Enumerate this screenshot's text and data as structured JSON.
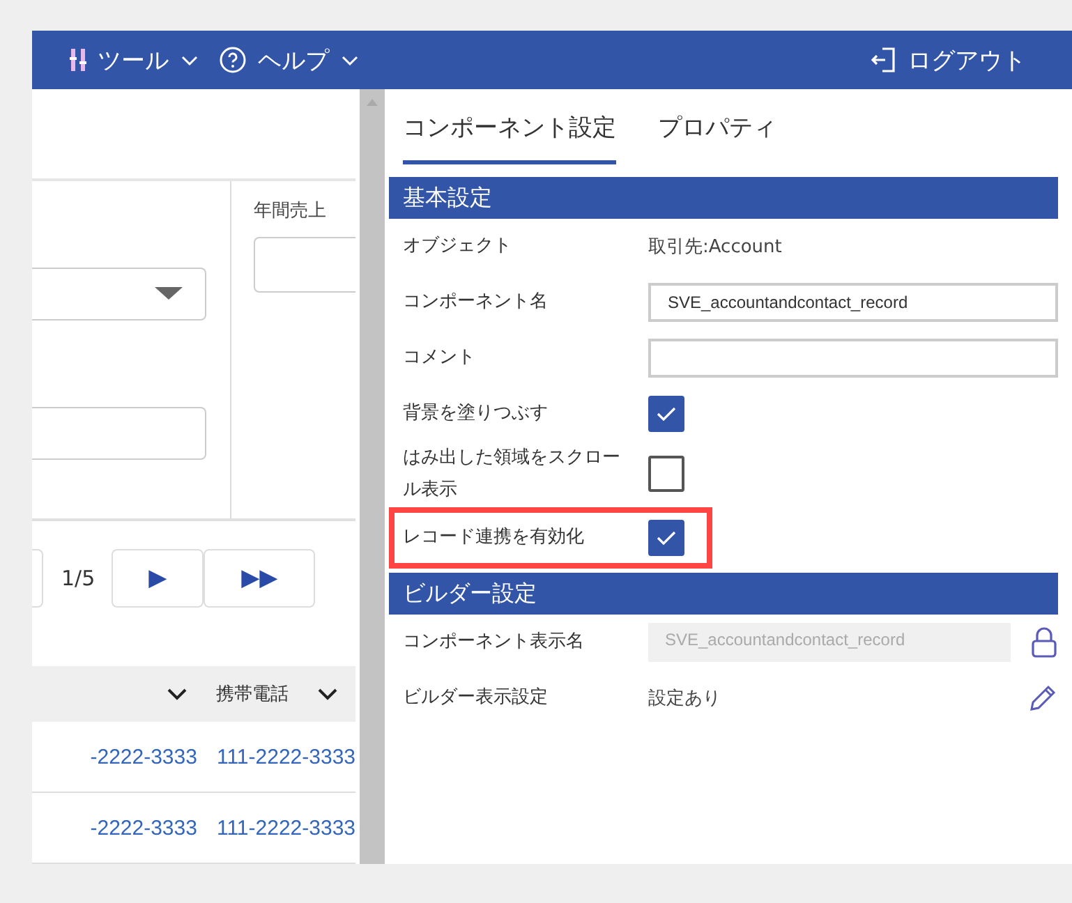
{
  "header": {
    "menus": [
      {
        "label": "ツール",
        "kind": "tools"
      },
      {
        "label": "ヘルプ",
        "kind": "help"
      }
    ],
    "logout": "ログアウト"
  },
  "left": {
    "field_label": "年間売上",
    "pager": {
      "page": "1/5",
      "next": "▶",
      "last": "▶▶"
    },
    "table": {
      "columns": [
        {
          "kind": "unlabeled"
        },
        {
          "kind": "labeled",
          "label": "携帯電話"
        }
      ],
      "rows": [
        [
          "-2222-3333",
          "111-2222-3333"
        ],
        [
          "-2222-3333",
          "111-2222-3333"
        ]
      ]
    }
  },
  "tabs": [
    {
      "label": "コンポーネント設定",
      "selected": true
    },
    {
      "label": "プロパティ",
      "selected": false
    }
  ],
  "sections": [
    {
      "title": "基本設定",
      "rows": [
        {
          "kind": "text",
          "label": "オブジェクト",
          "value": "取引先:Account"
        },
        {
          "kind": "input",
          "label": "コンポーネント名",
          "value": "SVE_accountandcontact_record"
        },
        {
          "kind": "input",
          "label": "コメント"
        },
        {
          "kind": "checkbox",
          "label": "背景を塗りつぶす",
          "checked": true
        },
        {
          "kind": "checkbox",
          "label": "はみ出した領域をスクロール表示",
          "checked": false
        },
        {
          "kind": "checkbox",
          "label": "レコード連携を有効化",
          "checked": true,
          "highlighted": true
        }
      ]
    },
    {
      "title": "ビルダー設定",
      "rows": [
        {
          "kind": "locked",
          "label": "コンポーネント表示名",
          "value": "SVE_accountandcontact_record"
        },
        {
          "kind": "edit",
          "label": "ビルダー表示設定",
          "value": "設定あり"
        }
      ]
    }
  ]
}
